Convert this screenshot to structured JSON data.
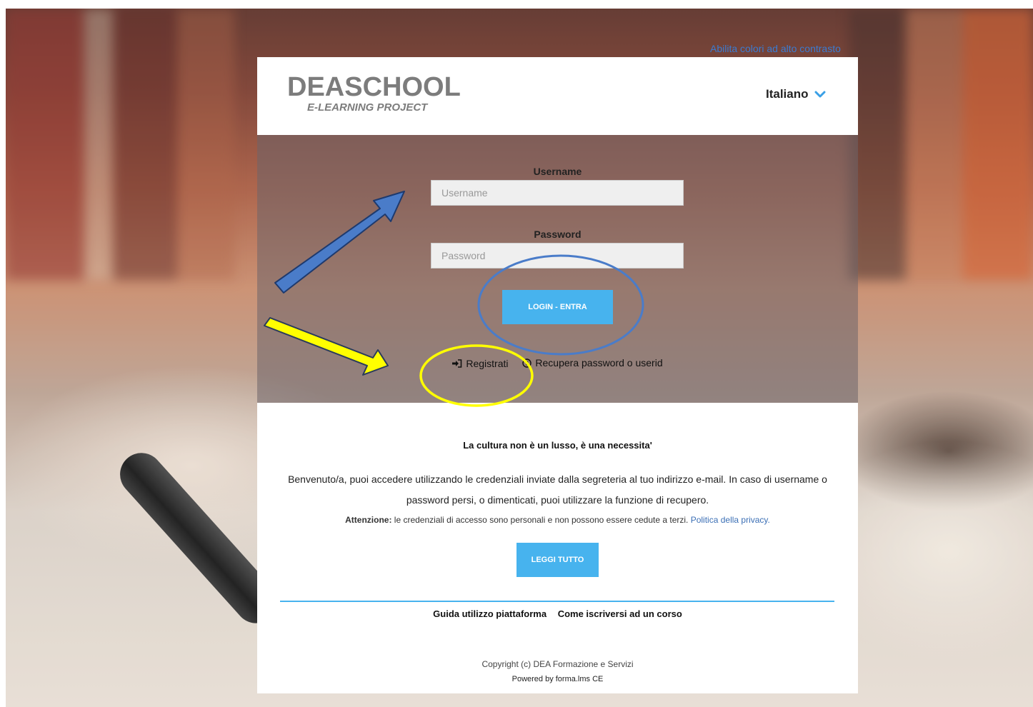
{
  "top_link": {
    "contrast": "Abilita colori ad alto contrasto"
  },
  "header": {
    "logo_main": "DEASCHOOL",
    "logo_sub": "E-LEARNING PROJECT",
    "language": "Italiano"
  },
  "login": {
    "username_label": "Username",
    "username_placeholder": "Username",
    "password_label": "Password",
    "password_placeholder": "Password",
    "login_button": "LOGIN - ENTRA",
    "register_link": "Registrati",
    "recover_link": "Recupera password o userid"
  },
  "info": {
    "motto": "La cultura non è un lusso, è una necessita'",
    "welcome": "Benvenuto/a, puoi accedere utilizzando le credenziali inviate dalla segreteria al tuo indirizzo e-mail. In caso di username o password persi, o dimenticati, puoi utilizzare la funzione di recupero.",
    "warning_bold": "Attenzione:",
    "warning_text": " le credenziali di accesso sono personali e non possono essere cedute a terzi. ",
    "privacy_link": "Politica della privacy.",
    "read_all_button": "LEGGI TUTTO",
    "guide_link": "Guida utilizzo piattaforma",
    "enroll_link": "Come iscriversi ad un corso",
    "copyright": "Copyright (c) DEA Formazione e Servizi",
    "powered_by": "Powered by forma.lms CE"
  },
  "colors": {
    "accent": "#47b3ee",
    "link": "#3b7bd1",
    "annotation_blue": "#4a7cc9",
    "annotation_yellow": "#ffff00"
  },
  "icons": {
    "language": "chevron-down-icon",
    "register": "sign-in-icon",
    "recover": "question-circle-icon"
  }
}
